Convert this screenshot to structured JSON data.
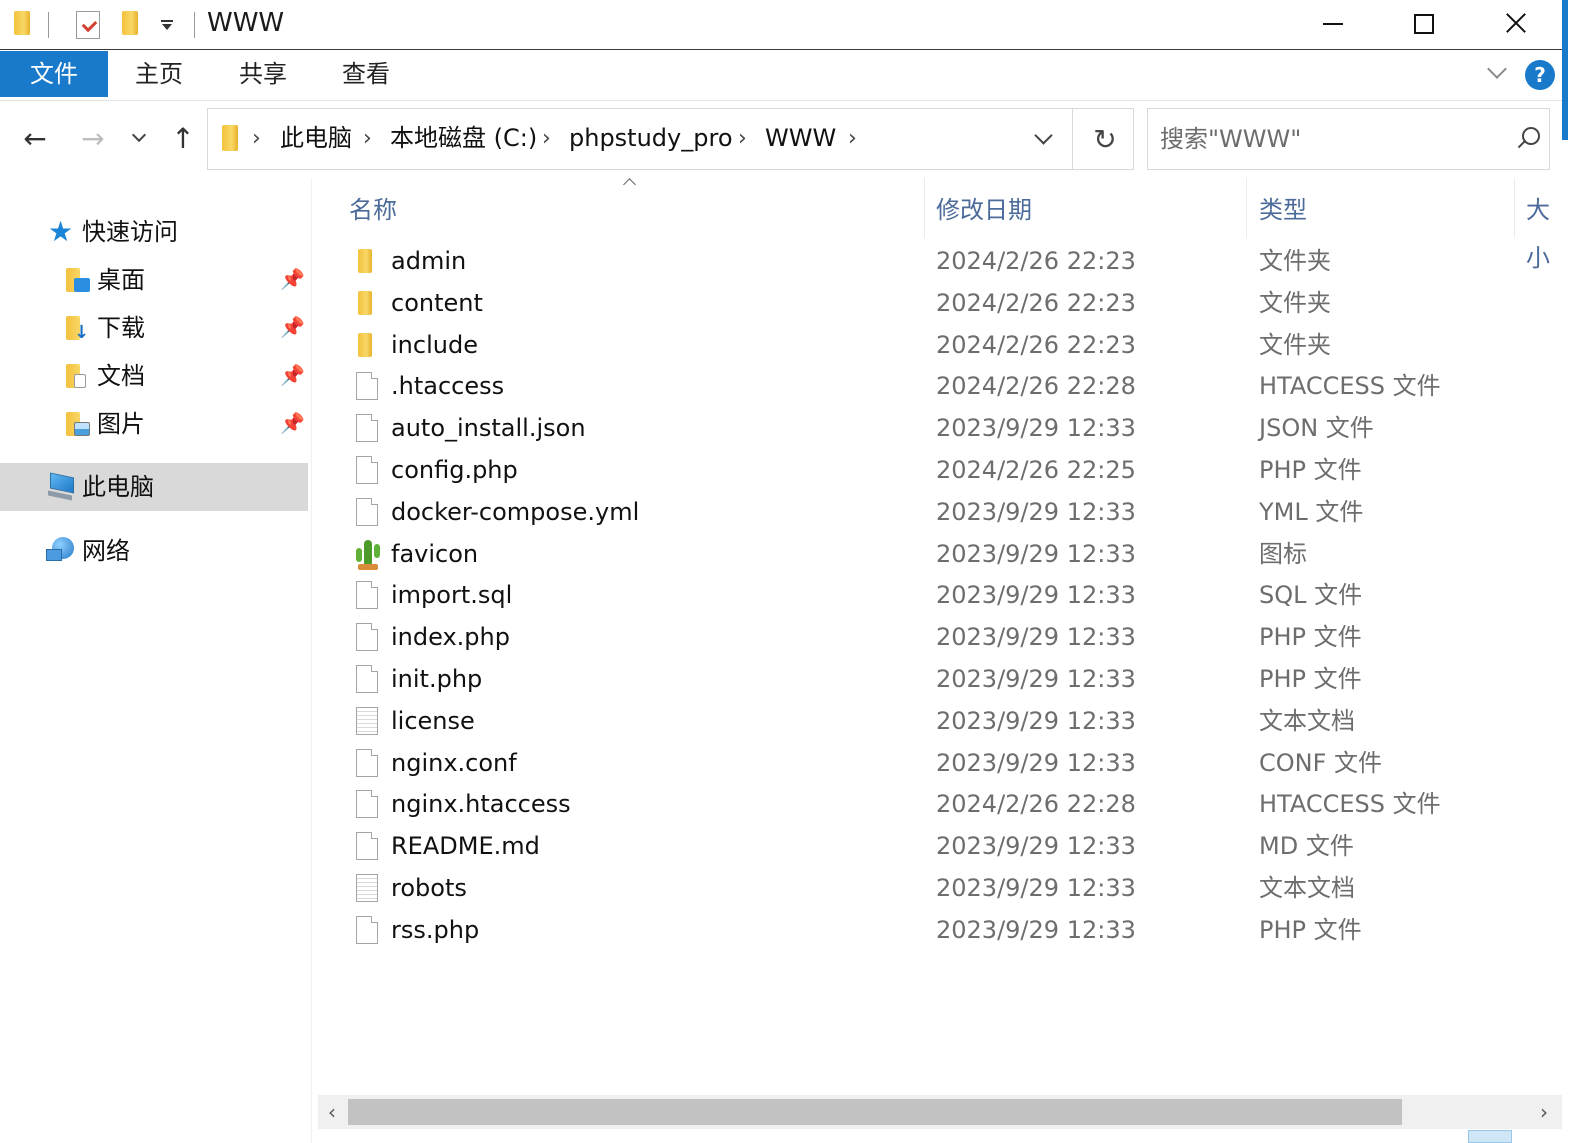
{
  "window": {
    "title": "WWW"
  },
  "ribbon": {
    "tabs": [
      {
        "label": "文件",
        "active": true
      },
      {
        "label": "主页"
      },
      {
        "label": "共享"
      },
      {
        "label": "查看"
      }
    ],
    "help_label": "?",
    "accent_color": "#1979ca"
  },
  "navigation": {
    "breadcrumb": [
      "此电脑",
      "本地磁盘 (C:)",
      "phpstudy_pro",
      "WWW"
    ],
    "search_placeholder": "搜索\"WWW\""
  },
  "sidebar": {
    "quick_access": "快速访问",
    "pinned": [
      {
        "label": "桌面",
        "icon": "desktop-folder-icon"
      },
      {
        "label": "下载",
        "icon": "downloads-folder-icon"
      },
      {
        "label": "文档",
        "icon": "documents-folder-icon"
      },
      {
        "label": "图片",
        "icon": "pictures-folder-icon"
      }
    ],
    "this_pc": "此电脑",
    "network": "网络"
  },
  "file_list": {
    "columns": [
      "名称",
      "修改日期",
      "类型",
      "大小"
    ],
    "rows": [
      {
        "name": "admin",
        "date": "2024/2/26 22:23",
        "type": "文件夹",
        "icon": "folder-icon"
      },
      {
        "name": "content",
        "date": "2024/2/26 22:23",
        "type": "文件夹",
        "icon": "folder-icon"
      },
      {
        "name": "include",
        "date": "2024/2/26 22:23",
        "type": "文件夹",
        "icon": "folder-icon"
      },
      {
        "name": ".htaccess",
        "date": "2024/2/26 22:28",
        "type": "HTACCESS 文件",
        "icon": "file-icon"
      },
      {
        "name": "auto_install.json",
        "date": "2023/9/29 12:33",
        "type": "JSON 文件",
        "icon": "file-icon"
      },
      {
        "name": "config.php",
        "date": "2024/2/26 22:25",
        "type": "PHP 文件",
        "icon": "file-icon"
      },
      {
        "name": "docker-compose.yml",
        "date": "2023/9/29 12:33",
        "type": "YML 文件",
        "icon": "file-icon"
      },
      {
        "name": "favicon",
        "date": "2023/9/29 12:33",
        "type": "图标",
        "icon": "cactus-icon"
      },
      {
        "name": "import.sql",
        "date": "2023/9/29 12:33",
        "type": "SQL 文件",
        "icon": "file-icon"
      },
      {
        "name": "index.php",
        "date": "2023/9/29 12:33",
        "type": "PHP 文件",
        "icon": "file-icon"
      },
      {
        "name": "init.php",
        "date": "2023/9/29 12:33",
        "type": "PHP 文件",
        "icon": "file-icon"
      },
      {
        "name": "license",
        "date": "2023/9/29 12:33",
        "type": "文本文档",
        "icon": "text-file-icon"
      },
      {
        "name": "nginx.conf",
        "date": "2023/9/29 12:33",
        "type": "CONF 文件",
        "icon": "file-icon"
      },
      {
        "name": "nginx.htaccess",
        "date": "2024/2/26 22:28",
        "type": "HTACCESS 文件",
        "icon": "file-icon"
      },
      {
        "name": "README.md",
        "date": "2023/9/29 12:33",
        "type": "MD 文件",
        "icon": "file-icon"
      },
      {
        "name": "robots",
        "date": "2023/9/29 12:33",
        "type": "文本文档",
        "icon": "text-file-icon"
      },
      {
        "name": "rss.php",
        "date": "2023/9/29 12:33",
        "type": "PHP 文件",
        "icon": "file-icon"
      }
    ]
  }
}
